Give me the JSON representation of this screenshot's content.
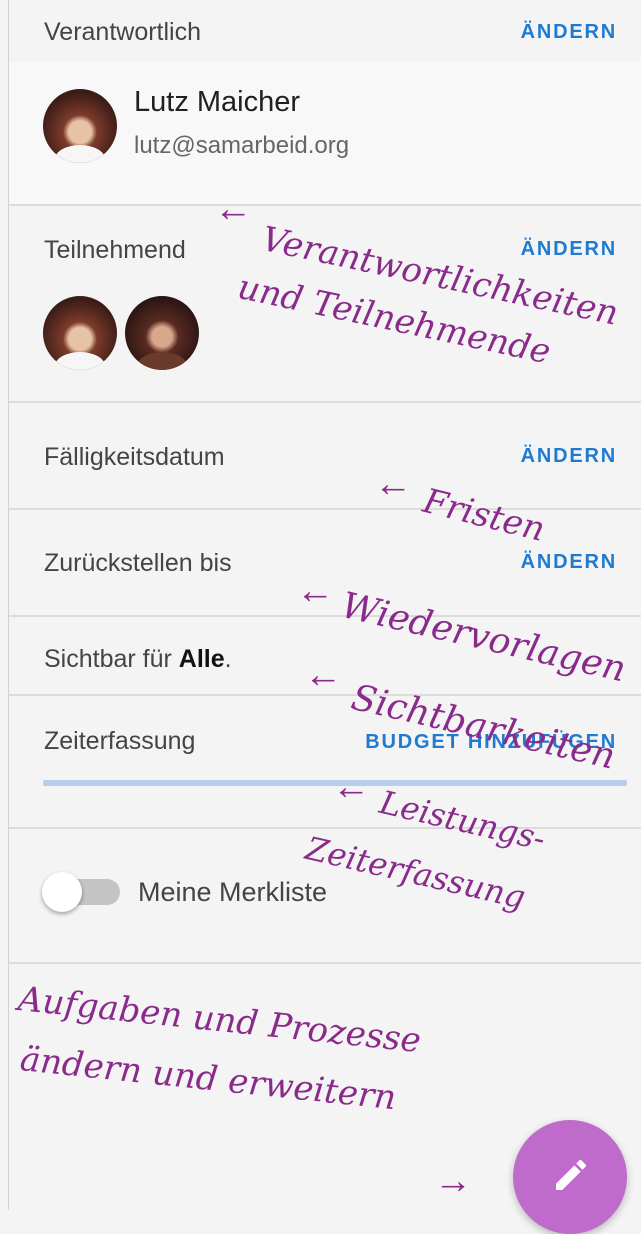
{
  "sections": {
    "responsible": {
      "label": "Verantwortlich",
      "action": "ÄNDERN",
      "owner": {
        "name": "Lutz Maicher",
        "email": "lutz@samarbeid.org"
      }
    },
    "participants": {
      "label": "Teilnehmend",
      "action": "ÄNDERN"
    },
    "due_date": {
      "label": "Fälligkeitsdatum",
      "action": "ÄNDERN"
    },
    "defer": {
      "label": "Zurückstellen bis",
      "action": "ÄNDERN"
    },
    "visibility": {
      "label_prefix": "Sichtbar für ",
      "value": "Alle",
      "suffix": "."
    },
    "time_tracking": {
      "label": "Zeiterfassung",
      "action": "BUDGET HINZUFÜGEN",
      "progress": 1.0
    },
    "watchlist": {
      "label": "Meine Merkliste",
      "enabled": false
    }
  },
  "annotations": {
    "a1_line1": "Verantwortlichkeiten",
    "a1_line2": "und Teilnehmende",
    "a2": "Fristen",
    "a3": "Wiedervorlagen",
    "a4": "Sichtbarkeiten",
    "a5_line1": "Leistungs-",
    "a5_line2": "Zeiterfassung",
    "a6_line1": "Aufgaben und Prozesse",
    "a6_line2": "ändern und erweitern"
  },
  "fab": {
    "icon": "pencil-icon"
  },
  "colors": {
    "accent": "#1f7ad1",
    "fab": "#bf6bcb",
    "annotation": "#8a2b8c",
    "progress": "#b7cfea"
  }
}
